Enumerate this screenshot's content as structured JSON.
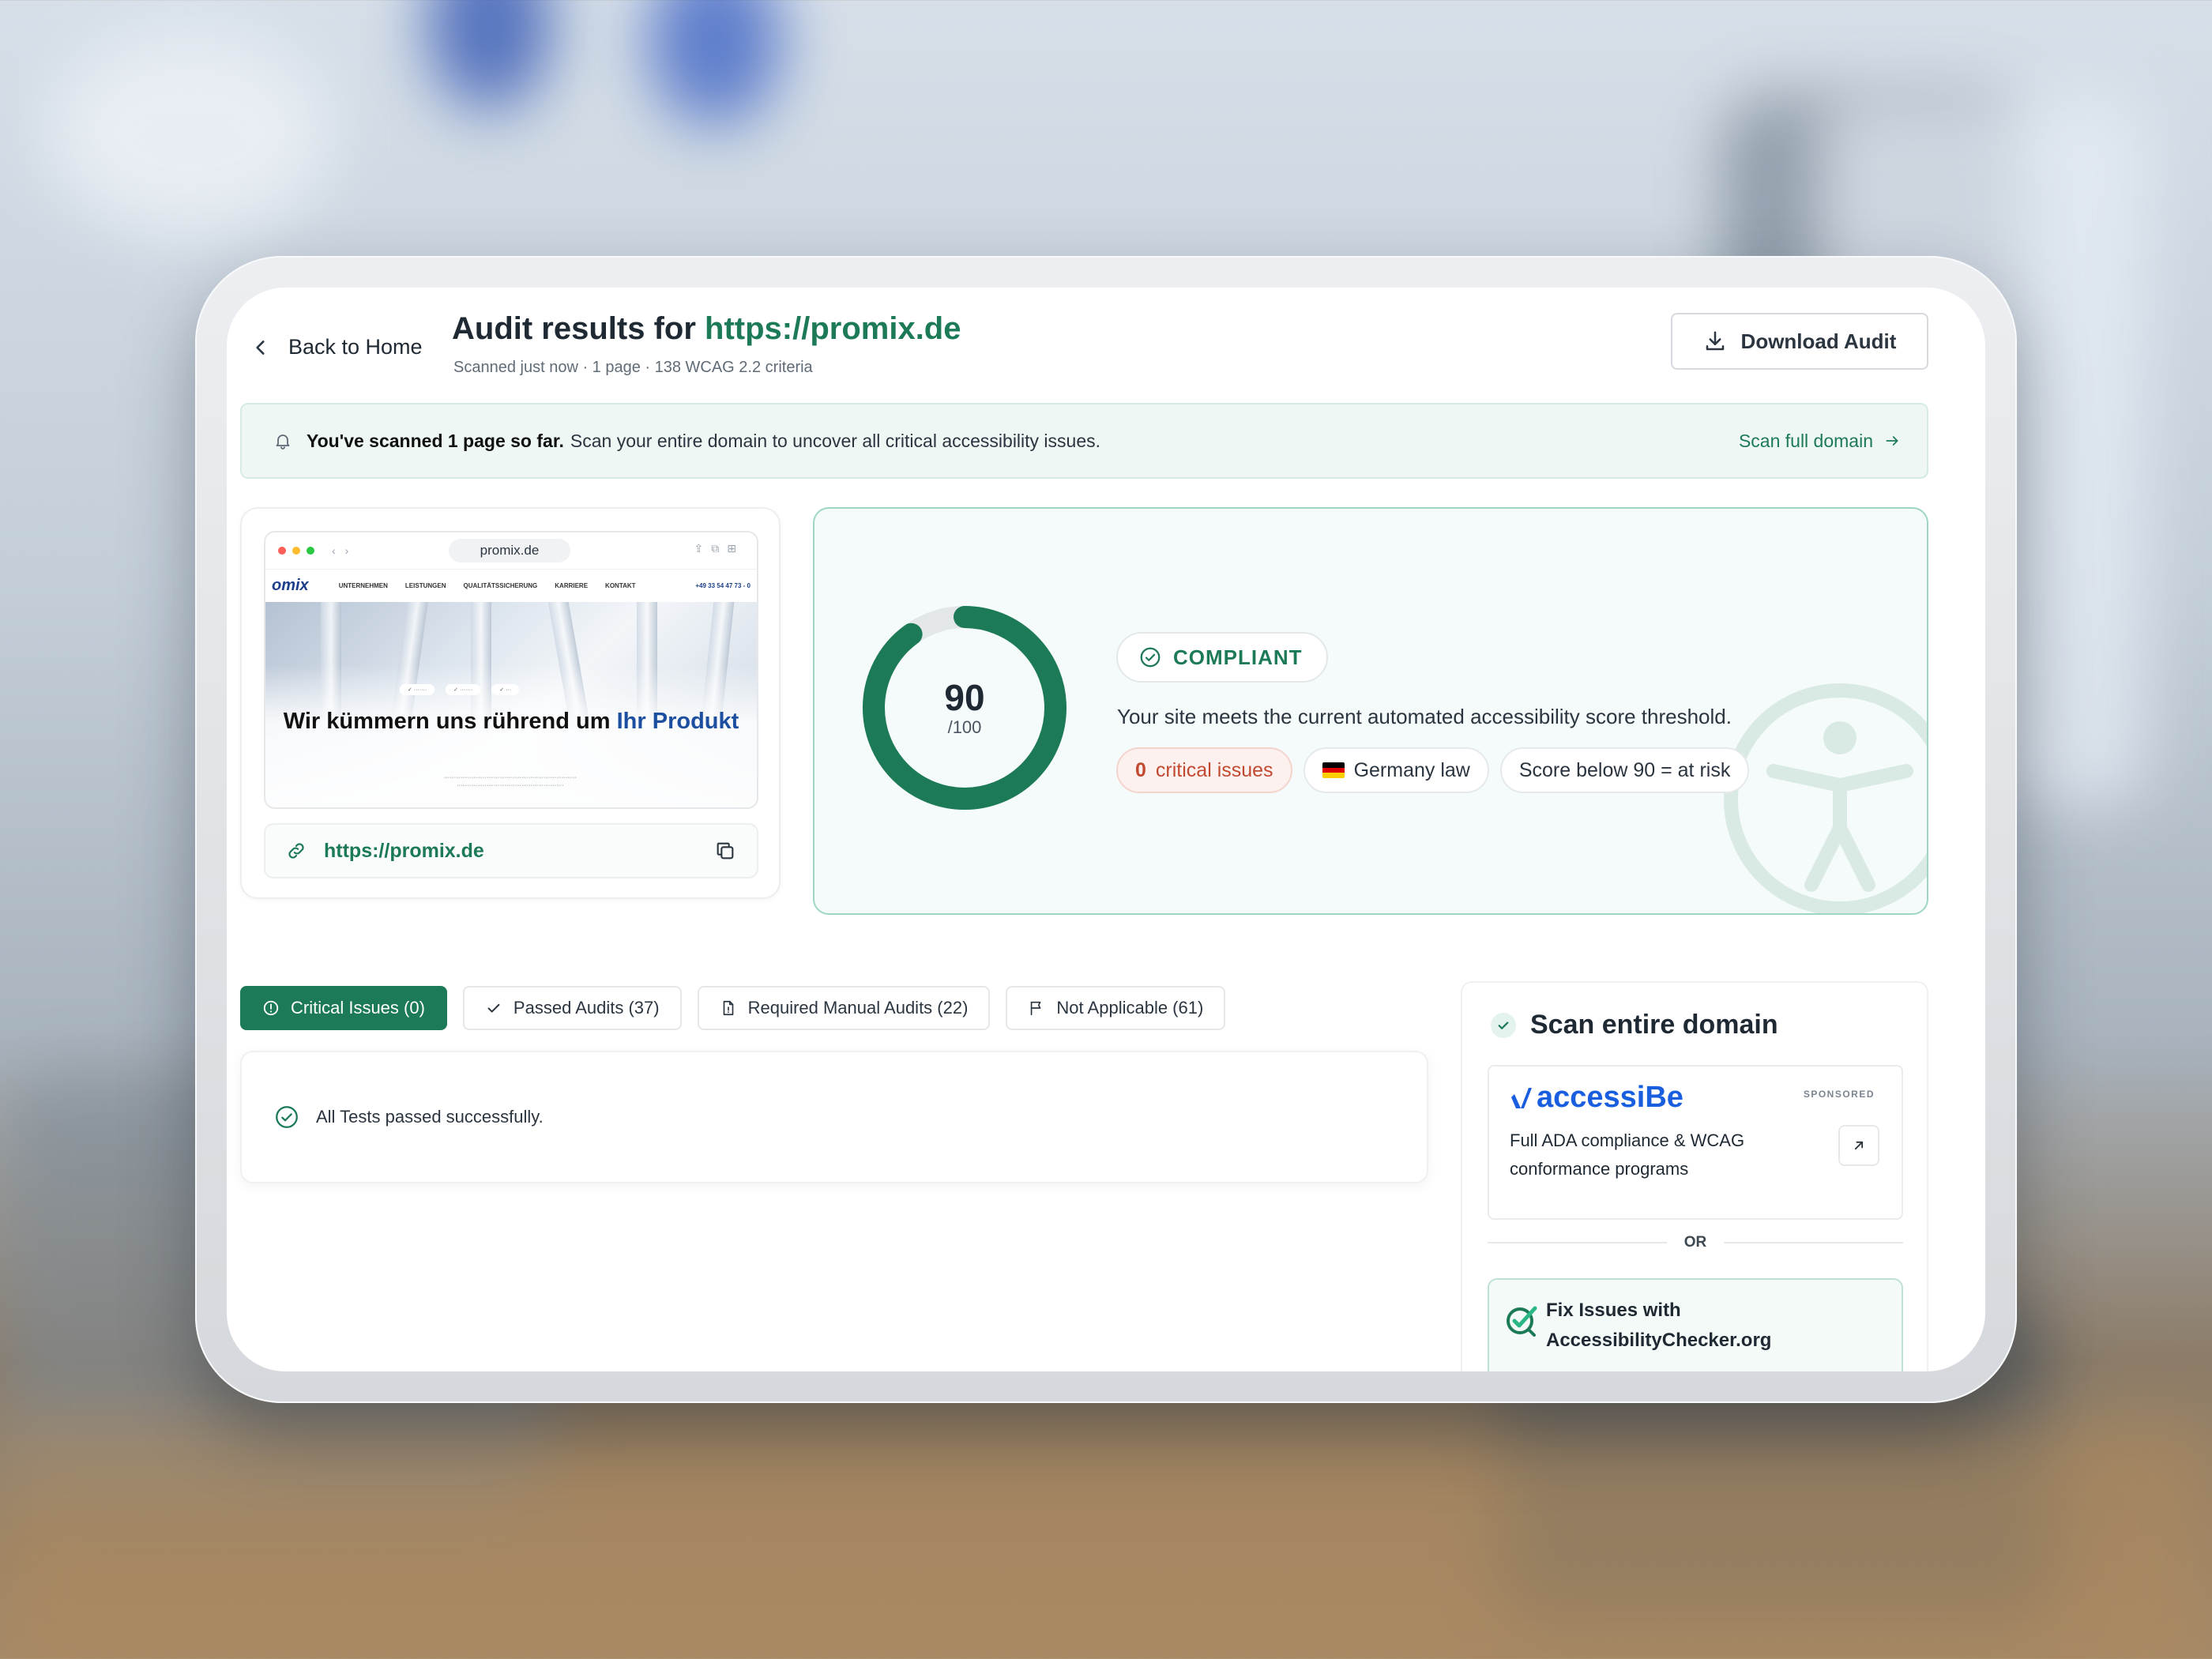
{
  "header": {
    "back_label": "Back to Home",
    "title_prefix": "Audit results for ",
    "title_url": "https://promix.de",
    "subtitle": "Scanned just now · 1 page · 138 WCAG 2.2 criteria",
    "download_label": "Download Audit"
  },
  "banner": {
    "bold_text": "You've scanned 1 page so far.",
    "text": "Scan your entire domain to uncover all critical accessibility issues.",
    "link_label": "Scan full domain"
  },
  "preview": {
    "browser_url": "promix.de",
    "site_logo": "omix",
    "site_nav": [
      "UNTERNEHMEN",
      "LEISTUNGEN",
      "QUALITÄTSSICHERUNG",
      "KARRIERE",
      "KONTAKT"
    ],
    "site_phone": "+49 33 54 47 73 - 0",
    "hero_title": "Wir kümmern uns rührend um",
    "hero_title_highlight": "Ihr Produkt",
    "url": "https://promix.de"
  },
  "score": {
    "value": 90,
    "max": 100,
    "value_label": "90",
    "max_label": "/100",
    "status": "COMPLIANT",
    "description": "Your site meets the current automated accessibility score threshold.",
    "critical_count": "0",
    "critical_label": "critical issues",
    "law_label": "Germany law",
    "threshold_label": "Score below 90 = at risk"
  },
  "tabs": [
    {
      "label": "Critical Issues (0)",
      "icon": "alert-circle-icon",
      "active": true
    },
    {
      "label": "Passed Audits (37)",
      "icon": "check-icon",
      "active": false
    },
    {
      "label": "Required Manual Audits (22)",
      "icon": "document-icon",
      "active": false
    },
    {
      "label": "Not Applicable (61)",
      "icon": "flag-icon",
      "active": false
    }
  ],
  "results": {
    "message": "All Tests passed successfully."
  },
  "sidebar": {
    "title": "Scan entire domain",
    "sponsor": {
      "name": "accessiBe",
      "tag": "SPONSORED",
      "description": "Full ADA compliance & WCAG conformance programs"
    },
    "or_label": "OR",
    "fix": {
      "label": "Fix Issues with AccessibilityChecker.org"
    }
  },
  "colors": {
    "brand_green": "#1c7a57",
    "critical_red": "#c2492f",
    "accessibe_blue": "#1a5ee0",
    "flag_de": [
      "#000000",
      "#dd0000",
      "#ffce00"
    ]
  }
}
